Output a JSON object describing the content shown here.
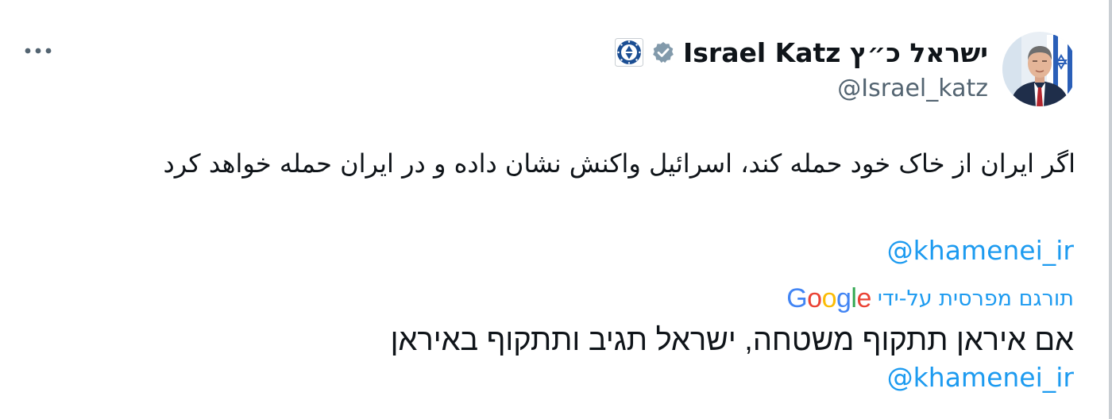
{
  "tweet": {
    "author": {
      "display_name": "ישראל כ״ץ Israel Katz",
      "handle": "@Israel_katz",
      "verified_icon": "verified-badge-icon",
      "affiliate_icon": "government-seal-icon"
    },
    "more_icon": "more-options-icon",
    "text": "اگر ایران از خاک خود حمله کند، اسرائیل واکنش نشان داده و در ایران حمله خواهد کرد",
    "mention": "@khamenei_ir",
    "translation": {
      "label": "תורגם מפרסית על-ידי",
      "provider": "Google",
      "text": "אם איראן תתקוף משטחה, ישראל תגיב ותתקוף באיראן",
      "mention": "@khamenei_ir"
    }
  },
  "colors": {
    "link": "#1d9bf0",
    "text": "#0f1419",
    "secondary": "#536471",
    "badge_gray": "#829aab"
  }
}
